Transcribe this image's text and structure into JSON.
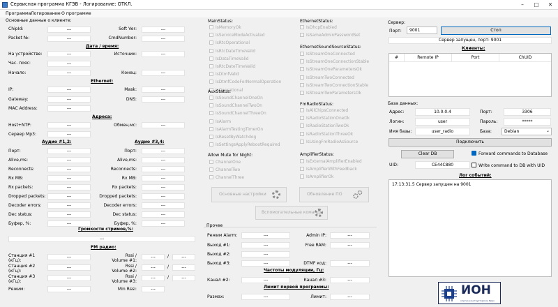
{
  "window": {
    "title": "Сервисная программа КГЭВ - Логирование: ОТКЛ."
  },
  "menu": [
    "Программа",
    "Логирование",
    "О программе"
  ],
  "basic": {
    "title": "Основные данные о клиенте:",
    "chipid": "ChipId:",
    "chipid_val": "---",
    "packet": "Packet №:",
    "packet_val": "---",
    "softver": "Soft Ver:",
    "softver_val": "---",
    "cmdnum": "CmdNumber:",
    "cmdnum_val": "---"
  },
  "date": {
    "title": "Дата / время:",
    "device": "На устройстве:",
    "device_val": "---",
    "tz": "Час. пояс:",
    "tz_val": "---",
    "start": "Начало:",
    "start_val": "---",
    "source": "Источник:",
    "source_val": "---",
    "end": "Конец:",
    "end_val": "---"
  },
  "ethernet": {
    "title": "Ethernet:",
    "ip": "IP:",
    "ip_val": "---",
    "gateway": "Gateway:",
    "gateway_val": "---",
    "mac": "MAC Address:",
    "mac_val": "---",
    "mask": "Mask:",
    "mask_val": "---",
    "dns": "DNS:",
    "dns_val": "---"
  },
  "addresses": {
    "title": "Адреса:",
    "host": "Host+NTP:",
    "host_val": "---",
    "mp3": "Сервер Mp3:",
    "mp3_val": "---",
    "exchange": "Обмен,мс:",
    "exchange_val": "---"
  },
  "audio": {
    "title1": "Аудио #1,2:",
    "title2": "Аудио #3,4:",
    "rows": [
      {
        "label": "Порт:",
        "v1": "---",
        "v2": "---"
      },
      {
        "label": "Alive,ms:",
        "v1": "---",
        "v2": "---"
      },
      {
        "label": "Reconnects:",
        "v1": "---",
        "v2": "---"
      },
      {
        "label": "Rx MB:",
        "v1": "---",
        "v2": "---"
      },
      {
        "label": "Rx packets:",
        "v1": "---",
        "v2": "---"
      },
      {
        "label": "Dropped packets:",
        "v1": "---",
        "v2": "---"
      },
      {
        "label": "Decoder errors:",
        "v1": "---",
        "v2": "---"
      },
      {
        "label": "Dec status:",
        "v1": "---",
        "v2": "---"
      },
      {
        "label": "Буфер, %:",
        "v1": "---",
        "v2": "---"
      }
    ]
  },
  "volume": {
    "title": "Громкости стримов,%:",
    "val": "---"
  },
  "fm": {
    "title": "FM радио:",
    "st1": "Станция #1\n(кГц):",
    "st1_val": "---",
    "st2": "Станция #2\n(кГц):",
    "st2_val": "---",
    "st3": "Станция #3\n(кГц):",
    "st3_val": "---",
    "rv1": "Rssi /\nVolume #1:",
    "rv1_a": "---",
    "rv1_b": "---",
    "rv2": "Rssi /\nVolume #2:",
    "rv2_a": "---",
    "rv2_b": "---",
    "rv3": "Rssi /\nVolume #3:",
    "rv3_a": "---",
    "rv3_b": "---",
    "mode": "Режим:",
    "mode_val": "---",
    "minrssi": "Min Rssi:",
    "minrssi_val": "---",
    "slash": "/"
  },
  "mainstatus": {
    "title": "MainStatus:",
    "items": [
      "IsMemoryOk",
      "IsServiceModeActivated",
      "IsRtcOperational",
      "IsRtcDateTimeValid",
      "IsDataTimeValid",
      "IsRtcDateTimeValid",
      "IsDtmfValid",
      "IsDtmfCodeForNormalOperation",
      "IsOperational"
    ]
  },
  "auxstatus": {
    "title": "AuxStatus:",
    "items": [
      "IsSoundChannelOneOn",
      "IsSoundChannelTwoOn",
      "IsSoundChannelThreeOn",
      "IsAlarm",
      "IsAlarmTestingTimerOn",
      "IsResetByWatchdog",
      "IsSettingsApplyRebootRequired"
    ]
  },
  "mute": {
    "title": "Allow Mute for Night:",
    "items": [
      "ChannelOne",
      "ChannelTwo",
      "ChannelThree"
    ]
  },
  "ethstatus": {
    "title": "EthernetStatus:",
    "items": [
      "IsDhcpEnabled",
      "IsSameAdminPasswordSet"
    ]
  },
  "ethsound": {
    "title": "EthernetSoundSourceStatus:",
    "items": [
      "IsStreamOneConnected",
      "IsStreamOneConnectionStable",
      "IsStreamOneParametersOk",
      "IsStreamTwoConnected",
      "IsStreamTwoConnectionStable",
      "IsStreamTwoParametersOk"
    ]
  },
  "fmradio": {
    "title": "FmRadioStatus:",
    "items": [
      "IsAllChipsConnected",
      "IsRadioStationOneOk",
      "IsRadioStationTwoOk",
      "IsRadioStationThreeOk",
      "IsUsingFmRadioAsSource"
    ]
  },
  "amp": {
    "title": "AmplifierStatus:",
    "items": [
      "IsExternalAmplifierEnabled",
      "IsAmplifierWithFeedback",
      "IsAmplifierOk"
    ]
  },
  "buttons": {
    "basic_settings": "Основные настройки",
    "update_po": "Обновление ПО",
    "aux_commands": "Вспомогательные команды"
  },
  "other": {
    "title": "Прочее",
    "alarm": "Режим Alarm:",
    "alarm_val": "---",
    "out1": "Выход #1:",
    "out1_val": "---",
    "out2": "Выход #2:",
    "out2_val": "---",
    "out3": "Выход #3:",
    "out3_val": "---",
    "adminip": "Admin IP:",
    "adminip_val": "---",
    "freeram": "Free RAM:",
    "freeram_val": "---",
    "dtmf": "DTMF код:",
    "dtmf_val": "---",
    "mod_title": "Частоты модуляции, Гц:",
    "ch2": "Канал #2:",
    "ch2_val": "---",
    "ch3": "Канал #3:",
    "ch3_val": "---",
    "limit_title": "Лимит первой программы:",
    "sizes": "Размах:",
    "sizes_val": "---",
    "limit": "Лимит:",
    "limit_val": "---"
  },
  "server": {
    "title": "Сервер:",
    "port_label": "Порт:",
    "port_val": "9001",
    "stop_button": "Стоп",
    "status": "Сервер запущен, порт: 9001",
    "clients_title": "Клиенты:",
    "columns": [
      "#",
      "Remote IP",
      "Port",
      "ChUID"
    ]
  },
  "db": {
    "title": "База данных:",
    "addr": "Адрес:",
    "addr_val": "10.0.0.4",
    "port": "Порт:",
    "port_val": "3306",
    "login": "Логин:",
    "login_val": "user",
    "password": "Пароль:",
    "password_val": "*****",
    "dbname": "Имя базы:",
    "dbname_val": "user_radio",
    "base": "База:",
    "base_val": "Debian",
    "connect": "Подключить",
    "clear": "Clear DB",
    "forward": "Forward commands to Database",
    "uid": "UID:",
    "uid_val": "CE44C880",
    "write": "Write command to DB with UID"
  },
  "log": {
    "title": "Лог событий:",
    "line": "17:13:31.5 Сервер запущен на 9001"
  },
  "logo": {
    "text": "ИОН",
    "sub": "опытно-конструкторское бюро"
  }
}
